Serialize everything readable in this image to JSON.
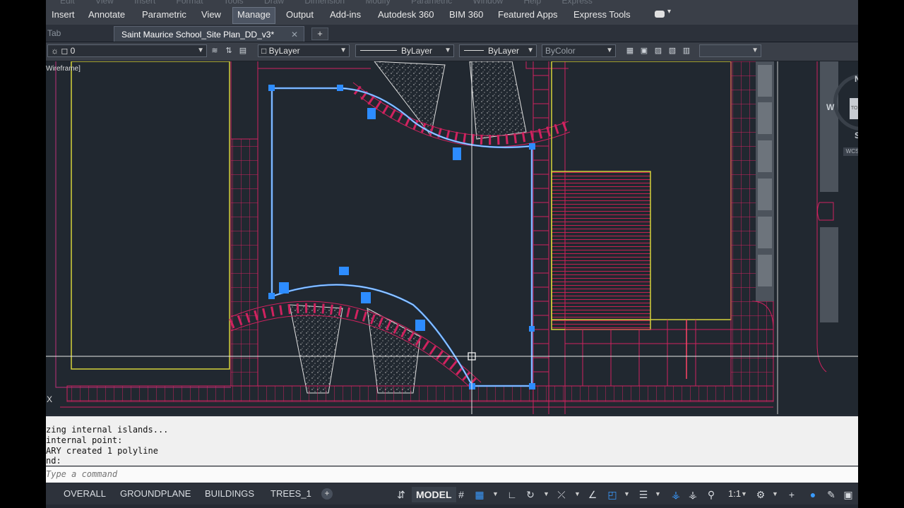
{
  "ribbon": {
    "ghost_menu": [
      "Edit",
      "View",
      "Insert",
      "Format",
      "Tools",
      "Draw",
      "Dimension",
      "Modify",
      "Parametric",
      "Window",
      "Help",
      "Express"
    ],
    "tabs": [
      {
        "label": "Insert",
        "x": 0
      },
      {
        "label": "Annotate",
        "x": 0
      },
      {
        "label": "Parametric",
        "x": 0
      },
      {
        "label": "View",
        "x": 0
      },
      {
        "label": "Manage",
        "x": 0,
        "active": true
      },
      {
        "label": "Output",
        "x": 0
      },
      {
        "label": "Add-ins",
        "x": 0
      },
      {
        "label": "Autodesk 360",
        "x": 0
      },
      {
        "label": "BIM 360",
        "x": 0
      },
      {
        "label": "Featured Apps",
        "x": 0
      },
      {
        "label": "Express Tools",
        "x": 0
      }
    ]
  },
  "doc_tabs": {
    "ghost": "Tab",
    "active": "Saint Maurice School_Site Plan_DD_v3*",
    "close": "✕",
    "add": "+"
  },
  "properties": {
    "layer": "0",
    "color": "ByLayer",
    "linetype": "ByLayer",
    "lineweight": "ByLayer",
    "plotstyle": "ByColor",
    "extra": ""
  },
  "viewport": {
    "style_label": "Wireframe]",
    "ucs_x": "X",
    "viewcube": {
      "north": "N",
      "west": "W",
      "south": "S",
      "face": "TOP",
      "wcs": "WCS"
    }
  },
  "command": {
    "history": [
      "zing internal islands...",
      "internal point:",
      "ARY created 1 polyline",
      "nd:"
    ],
    "placeholder": "Type a command"
  },
  "layout_tabs": [
    "OVERALL",
    "GROUNDPLANE",
    "BUILDINGS",
    "TREES_1"
  ],
  "layout_add": "+",
  "status": {
    "model": "MODEL",
    "scale": "1:1"
  },
  "colors": {
    "polyline": "#4a9bff",
    "curb": "#d0225f",
    "building": "#d6d23a",
    "grid": "#e8e8e8"
  }
}
